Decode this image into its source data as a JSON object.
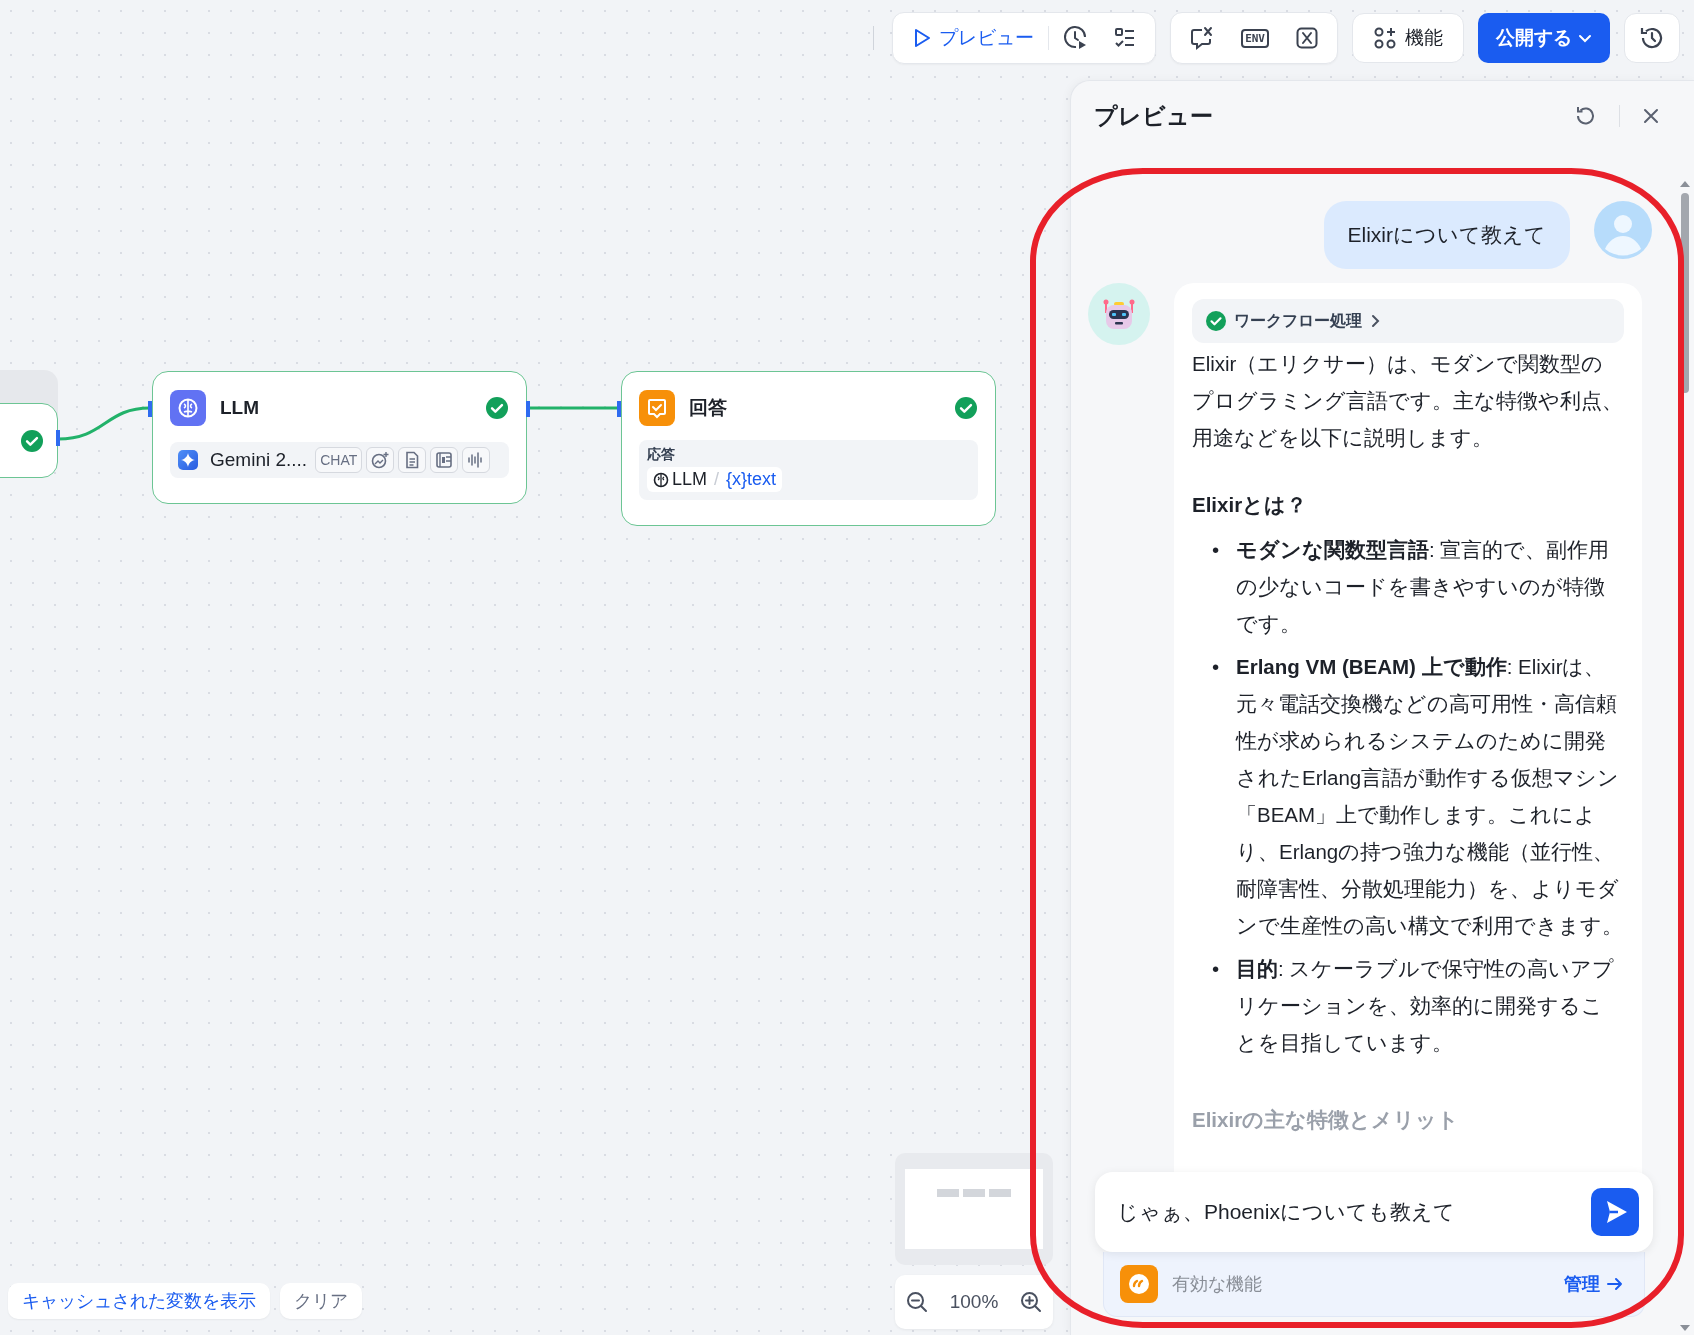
{
  "toolbar": {
    "preview_button": "プレビュー",
    "env_button": "ENV",
    "features_button": "機能",
    "publish_button": "公開する"
  },
  "canvas": {
    "nodes": [
      {
        "kind": "partial",
        "completed": true
      },
      {
        "kind": "llm",
        "title": "LLM",
        "completed": true,
        "model": "Gemini 2....",
        "tags": [
          "CHAT"
        ]
      },
      {
        "kind": "answer",
        "title": "回答",
        "completed": true,
        "field_label": "応答",
        "ref_node": "LLM",
        "ref_separator": "/",
        "ref_var_mark": "{x}",
        "ref_var": "text"
      }
    ],
    "zoom": "100%",
    "cached_vars_button": "キャッシュされた変数を表示",
    "clear_button": "クリア"
  },
  "preview": {
    "title": "プレビュー",
    "messages": [
      {
        "kind": "user",
        "text": "Elixirについて教えて"
      },
      {
        "kind": "bot",
        "workflow_label": "ワークフロー処理",
        "workflow_completed": true,
        "blocks": [
          {
            "kind": "paragraph",
            "text": "Elixir（エリクサー）は、モダンで関数型のプログラミング言語です。主な特徴や利点、用途などを以下に説明します。"
          },
          {
            "kind": "heading",
            "text": "Elixirとは？"
          },
          {
            "kind": "list",
            "marker": "•",
            "items": [
              "**モダンな関数型言語**: 宣言的で、副作用の少ないコードを書きやすいのが特徴です。",
              "**Erlang VM (BEAM) 上で動作**: Elixirは、元々電話交換機などの高可用性・高信頼性が求められるシステムのために開発されたErlang言語が動作する仮想マシン「BEAM」上で動作します。これにより、Erlangの持つ強力な機能（並行性、耐障害性、分散処理能力）を、よりモダンで生産性の高い構文で利用できます。",
              "**目的**: スケーラブルで保守性の高いアプリケーションを、効率的に開発することを目指しています。"
            ]
          },
          {
            "kind": "heading",
            "text": "Elixirの主な特徴とメリット"
          }
        ]
      }
    ],
    "input": {
      "value": "じゃぁ、Phoenixについても教えて"
    },
    "features": {
      "label": "有効な機能",
      "manage_link": "管理"
    }
  }
}
